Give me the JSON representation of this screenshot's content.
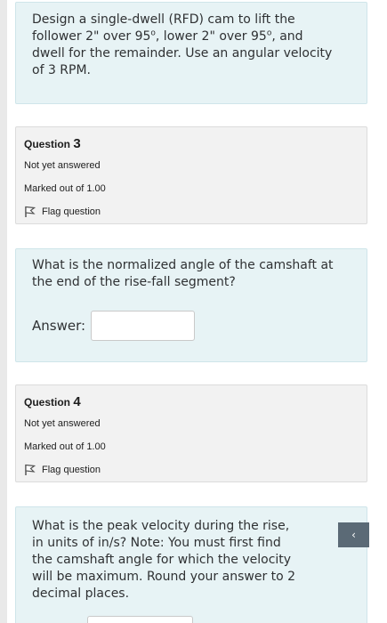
{
  "prev_question": {
    "text_l1_pre": "Design a single-dwell (RFD) cam to lift the",
    "text_l2_a": "follower 2\" over 95",
    "deg1": "o",
    "text_l2_b": ", lower 2\" over 95",
    "deg2": "o",
    "text_l2_c": ", and",
    "text_l3": "dwell for the remainder. Use an angular velocity",
    "text_l4": "of 3 RPM."
  },
  "q3": {
    "prefix": "Question ",
    "number": "3",
    "status": "Not yet answered",
    "marked": "Marked out of 1.00",
    "flag_label": "Flag question",
    "text": "What is the normalized angle of the camshaft at the end of the rise-fall segment?",
    "answer_label": "Answer:",
    "answer_value": ""
  },
  "q4": {
    "prefix": "Question ",
    "number": "4",
    "status": "Not yet answered",
    "marked": "Marked out of 1.00",
    "flag_label": "Flag question",
    "text": "What is the peak velocity during the rise, in units of in/s? Note: You must first find the camshaft angle for which the velocity will be maximum. Round your answer to 2 decimal places."
  },
  "scroll_button": {
    "icon": "chevron-up-icon",
    "glyph": "‹"
  },
  "colors": {
    "question_text_bg": "#e7f3f5",
    "info_bg": "#f2f2f2",
    "scroll_button_bg": "#5b6a76"
  }
}
